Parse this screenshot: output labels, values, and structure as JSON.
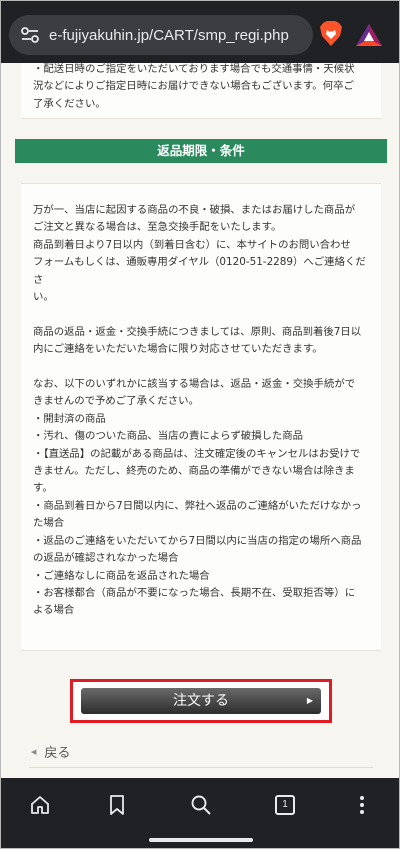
{
  "browser": {
    "url": "e-fujiyakuhin.jp/CART/smp_regi.php",
    "tab_count": "1"
  },
  "card_top": {
    "lines": [
      "・配送日時のご指定をいただいております場合でも交通事情・天候状",
      "況などによりご指定日時にお届けできない場合もございます。何卒ご",
      "了承ください。"
    ]
  },
  "section": {
    "title": "返品期限・条件"
  },
  "returns": {
    "lines": [
      "万が一、当店に起因する商品の不良・破損、またはお届けした商品が",
      "ご注文と異なる場合は、至急交換手配をいたします。",
      "商品到着日より7日以内（到着日含む）に、本サイトのお問い合わせ",
      "フォームもしくは、通販専用ダイヤル（0120-51-2289）へご連絡くださ",
      "い。",
      "",
      "商品の返品・返金・交換手続につきましては、原則、商品到着後7日以",
      "内にご連絡をいただいた場合に限り対応させていただきます。",
      "",
      "なお、以下のいずれかに該当する場合は、返品・返金・交換手続がで",
      "きませんので予めご了承ください。",
      "・開封済の商品",
      "・汚れ、傷のついた商品、当店の責によらず破損した商品",
      "・【直送品】の記載がある商品は、注文確定後のキャンセルはお受けで",
      "きません。ただし、終売のため、商品の準備ができない場合は除きま",
      "す。",
      "・商品到着日から7日間以内に、弊社へ返品のご連絡がいただけなかっ",
      "た場合",
      "・返品のご連絡をいただいてから7日間以内に当店の指定の場所へ商品",
      "の返品が確認されなかった場合",
      "・ご連絡なしに商品を返品された場合",
      "・お客様都合（商品が不要になった場合、長期不在、受取拒否等）に",
      "よる場合"
    ]
  },
  "actions": {
    "order_label": "注文する",
    "back_label": "戻る"
  },
  "icons": [
    "tune-icon",
    "brave-lion-icon",
    "bat-rewards-icon",
    "home-icon",
    "bookmark-icon",
    "search-icon",
    "tabs-icon",
    "more-menu-icon"
  ],
  "colors": {
    "section_green": "#2a8a5e",
    "highlight_red": "#e01b24",
    "browser_chrome": "#202124"
  }
}
